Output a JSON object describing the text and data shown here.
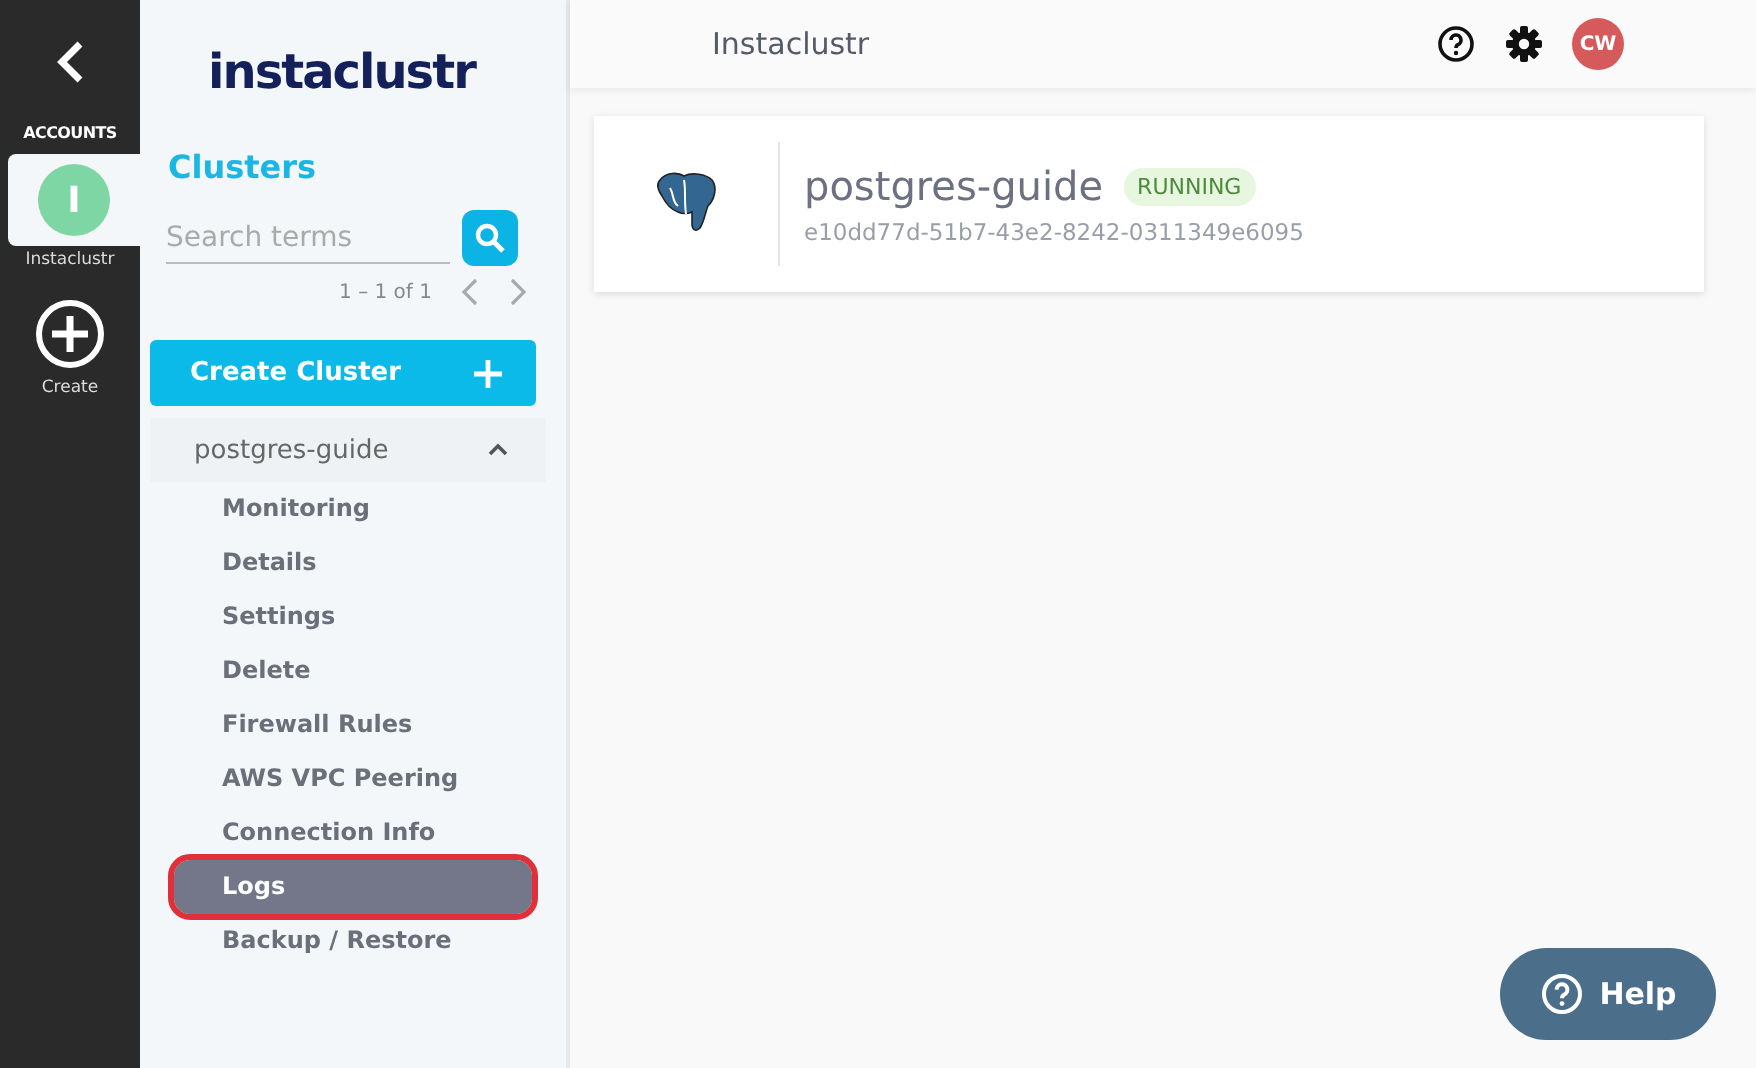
{
  "rail": {
    "section_label": "ACCOUNTS",
    "accounts": [
      {
        "initial": "I",
        "name": "Instaclustr",
        "selected": true,
        "color": "#7ed6a4"
      }
    ],
    "create_label": "Create"
  },
  "sidebar": {
    "logo": "instaclustr",
    "heading": "Clusters",
    "search": {
      "placeholder": "Search terms"
    },
    "pagination": "1 – 1 of 1",
    "create_button": "Create Cluster",
    "cluster": {
      "name": "postgres-guide",
      "expanded": true,
      "items": [
        {
          "label": "Monitoring",
          "selected": false,
          "highlighted": false
        },
        {
          "label": "Details",
          "selected": false,
          "highlighted": false
        },
        {
          "label": "Settings",
          "selected": false,
          "highlighted": false
        },
        {
          "label": "Delete",
          "selected": false,
          "highlighted": false
        },
        {
          "label": "Firewall Rules",
          "selected": false,
          "highlighted": false
        },
        {
          "label": "AWS VPC Peering",
          "selected": false,
          "highlighted": false
        },
        {
          "label": "Connection Info",
          "selected": false,
          "highlighted": false
        },
        {
          "label": "Logs",
          "selected": true,
          "highlighted": true
        },
        {
          "label": "Backup / Restore",
          "selected": false,
          "highlighted": false
        }
      ]
    }
  },
  "header": {
    "title": "Instaclustr",
    "user_initials": "CW"
  },
  "cluster_card": {
    "name": "postgres-guide",
    "status": "RUNNING",
    "id": "e10dd77d-51b7-43e2-8242-0311349e6095"
  },
  "help_button": "Help"
}
